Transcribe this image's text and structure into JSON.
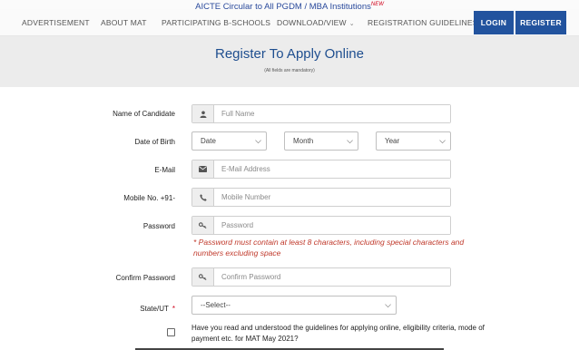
{
  "announcement": {
    "text": "AICTE Circular to All PGDM / MBA Institutions",
    "badge": "NEW"
  },
  "nav": {
    "items": [
      "ADVERTISEMENT",
      "ABOUT MAT",
      "PARTICIPATING B-SCHOOLS",
      "DOWNLOAD/VIEW",
      "REGISTRATION GUIDELINES"
    ],
    "login": "LOGIN",
    "register": "REGISTER",
    "brand_color": "#22539e"
  },
  "banner": {
    "title": "Register To Apply Online",
    "subtitle": "(All fields are mandatory)"
  },
  "form": {
    "name": {
      "label": "Name of Candidate",
      "placeholder": "Full Name",
      "icon": "user-icon"
    },
    "dob": {
      "label": "Date of Birth",
      "date": "Date",
      "month": "Month",
      "year": "Year"
    },
    "email": {
      "label": "E-Mail",
      "placeholder": "E-Mail Address",
      "icon": "envelope-icon"
    },
    "mobile": {
      "label": "Mobile No. +91-",
      "placeholder": "Mobile Number",
      "icon": "phone-icon"
    },
    "password": {
      "label": "Password",
      "placeholder": "Password",
      "icon": "key-icon",
      "hint": "* Password must contain at least 8 characters, including special characters and numbers excluding space"
    },
    "confirm": {
      "label": "Confirm Password",
      "placeholder": "Confirm Password",
      "icon": "key-icon"
    },
    "state": {
      "label": "State/UT",
      "required_mark": "*",
      "selected": "--Select--"
    },
    "agreement": "Have you read and understood the guidelines for applying online, eligibility criteria, mode of payment etc. for MAT May 2021?"
  }
}
